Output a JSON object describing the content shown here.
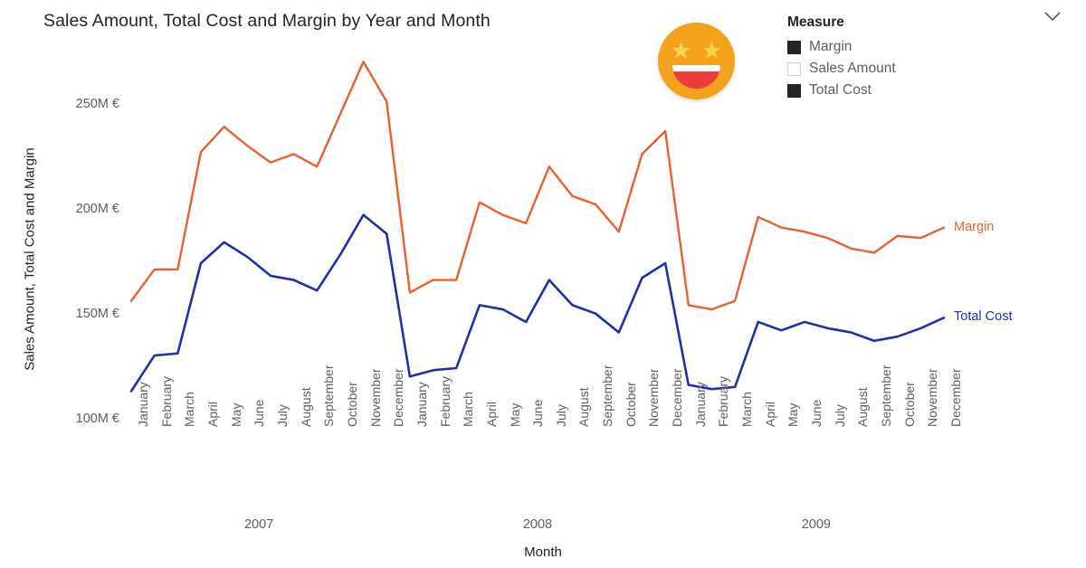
{
  "header": {
    "title": "Sales Amount, Total Cost and Margin by Year and Month"
  },
  "emoji": {
    "name": "star-struck-emoji",
    "face_color": "#F3A21C",
    "star_color": "#FFD24D",
    "mouth_color": "#EE3B3B",
    "teeth_color": "#FFFFFF"
  },
  "legend": {
    "title": "Measure",
    "expand_icon": "chevron-down-icon",
    "items": [
      {
        "label": "Margin",
        "checked": true
      },
      {
        "label": "Sales Amount",
        "checked": false
      },
      {
        "label": "Total Cost",
        "checked": true
      }
    ]
  },
  "series_end_labels": [
    {
      "label": "Margin",
      "color": "#E8602C"
    },
    {
      "label": "Total Cost",
      "color": "#2030A8"
    }
  ],
  "chart_data": {
    "type": "line",
    "title": "Sales Amount, Total Cost and Margin by Year and Month",
    "xlabel": "Month",
    "ylabel": "Sales Amount, Total Cost and Margin",
    "ylim": [
      100,
      280
    ],
    "yticks": [
      100,
      150,
      200,
      250
    ],
    "ytick_labels": [
      "100M €",
      "150M €",
      "200M €",
      "250M €"
    ],
    "grid": false,
    "legend_position": "right-inline",
    "units": "M €",
    "years": [
      "2007",
      "2008",
      "2009"
    ],
    "months": [
      "January",
      "February",
      "March",
      "April",
      "May",
      "June",
      "July",
      "August",
      "September",
      "October",
      "November",
      "December"
    ],
    "categories": [
      "2007 January",
      "2007 February",
      "2007 March",
      "2007 April",
      "2007 May",
      "2007 June",
      "2007 July",
      "2007 August",
      "2007 September",
      "2007 October",
      "2007 November",
      "2007 December",
      "2008 January",
      "2008 February",
      "2008 March",
      "2008 April",
      "2008 May",
      "2008 June",
      "2008 July",
      "2008 August",
      "2008 September",
      "2008 October",
      "2008 November",
      "2008 December",
      "2009 January",
      "2009 February",
      "2009 March",
      "2009 April",
      "2009 May",
      "2009 June",
      "2009 July",
      "2009 August",
      "2009 September",
      "2009 October",
      "2009 November",
      "2009 December"
    ],
    "series": [
      {
        "name": "Margin",
        "color": "#E8602C",
        "values": [
          157,
          172,
          172,
          228,
          240,
          231,
          223,
          227,
          221,
          246,
          271,
          252,
          161,
          167,
          167,
          204,
          198,
          194,
          221,
          207,
          203,
          190,
          227,
          238,
          155,
          153,
          157,
          197,
          192,
          190,
          187,
          182,
          180,
          188,
          187,
          192
        ]
      },
      {
        "name": "Total Cost",
        "color": "#2030A8",
        "values": [
          114,
          131,
          132,
          175,
          185,
          178,
          169,
          167,
          162,
          179,
          198,
          189,
          121,
          124,
          125,
          155,
          153,
          147,
          167,
          155,
          151,
          142,
          168,
          175,
          117,
          115,
          116,
          147,
          143,
          147,
          144,
          142,
          138,
          140,
          144,
          149
        ]
      }
    ]
  }
}
